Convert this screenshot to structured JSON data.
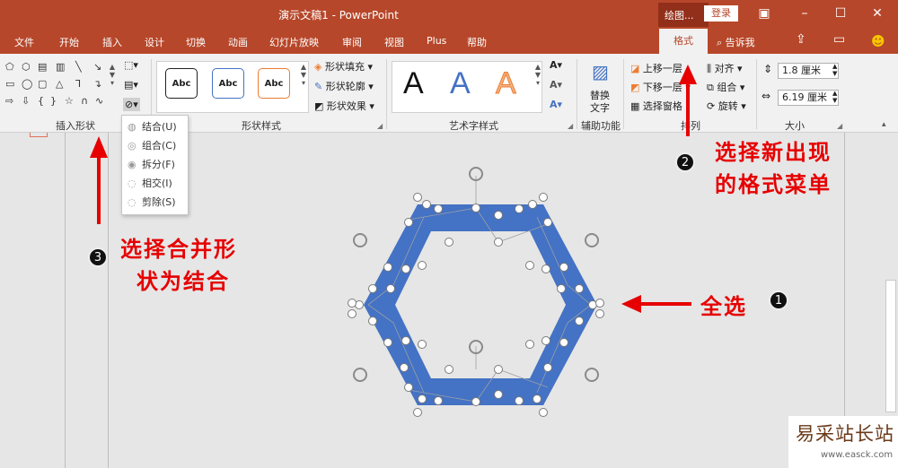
{
  "titlebar": {
    "title": "演示文稿1 - PowerPoint",
    "context_group": "绘图...",
    "login": "登录"
  },
  "tabs": [
    "文件",
    "开始",
    "插入",
    "设计",
    "切换",
    "动画",
    "幻灯片放映",
    "审阅",
    "视图",
    "Plus",
    "帮助"
  ],
  "active_tab": "格式",
  "tell_me": "告诉我",
  "ribbon": {
    "groups": {
      "insert_shapes": "插入形状",
      "shape_styles": "形状样式",
      "wordart_styles": "艺术字样式",
      "accessibility": "辅助功能",
      "arrange": "排列",
      "size": "大小"
    },
    "style_samples": [
      "Abc",
      "Abc",
      "Abc"
    ],
    "shape_fill": "形状填充",
    "shape_outline": "形状轮廓",
    "shape_effects": "形状效果",
    "wordart_samples": [
      "A",
      "A",
      "A"
    ],
    "alt_text_line1": "替换",
    "alt_text_line2": "文字",
    "bring_forward": "上移一层",
    "send_backward": "下移一层",
    "selection_pane": "选择窗格",
    "align": "对齐",
    "group": "组合",
    "rotate": "旋转",
    "height": "1.8 厘米",
    "width": "6.19 厘米"
  },
  "merge_menu": {
    "items": [
      "结合(U)",
      "组合(C)",
      "拆分(F)",
      "相交(I)",
      "剪除(S)"
    ]
  },
  "annotations": {
    "step2_line1": "选择新出现",
    "step2_line2": "的格式菜单",
    "step3_line1": "选择合并形",
    "step3_line2": "状为结合",
    "step1": "全选",
    "badge1": "1",
    "badge2": "2",
    "badge3": "3"
  },
  "watermark": {
    "text": "易采站长站",
    "url": "www.easck.com"
  },
  "colors": {
    "accent": "#b7472a",
    "shape_fill": "#4472c4",
    "annotation": "#e60000"
  }
}
